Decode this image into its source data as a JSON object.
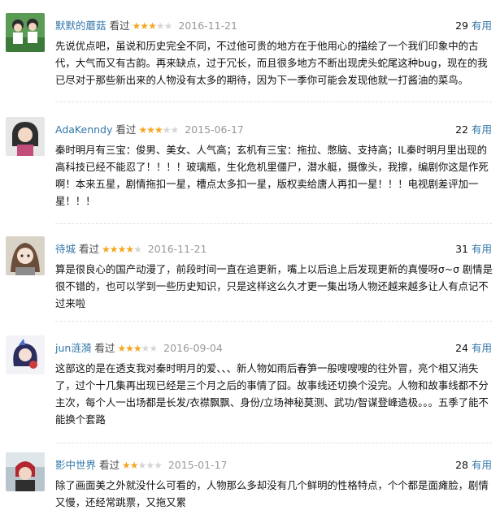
{
  "reviews": [
    {
      "username": "默默的蘑菇",
      "action": "看过",
      "rating": 3,
      "date": "2016-11-21",
      "useful_count": "29",
      "useful_label": "有用",
      "text": "先说优点吧，虽说和历史完全不同，不过他可贵的地方在于他用心的描绘了一个我们印象中的古代，大气而又有古韵。再来缺点，过于冗长，而且很多地方不断出现虎头蛇尾这种bug，现在的我已尽对于那些新出来的人物没有太多的期待，因为下一季你可能会发现他就一打酱油的菜鸟。"
    },
    {
      "username": "AdaKenndy",
      "action": "看过",
      "rating": 3,
      "date": "2015-06-17",
      "useful_count": "22",
      "useful_label": "有用",
      "text": "秦时明月有三宝：俊男、美女、人气高；玄机有三宝：拖拉、憋脑、支持高；IL秦时明月里出现的高科技已经不能忍了！！！！玻璃瓶，生化危机里僵尸，潜水艇，摄像头，我擦，编剧你这是作死啊！本来五星，剧情拖扣一星，槽点太多扣一星，版权卖给唐人再扣一星！！！电视剧差评加一星！！！"
    },
    {
      "username": "待城",
      "action": "看过",
      "rating": 4,
      "date": "2016-11-21",
      "useful_count": "31",
      "useful_label": "有用",
      "text": "算是很良心的国产动漫了，前段时间一直在追更新，嘴上以后追上后发现更新的真慢呀σ~σ 剧情是很不错的，也可以学到一些历史知识，只是这样这么久才更一集出场人物还越来越多让人有点记不过来啦"
    },
    {
      "username": "jun涟漪",
      "action": "看过",
      "rating": 3,
      "date": "2016-09-04",
      "useful_count": "24",
      "useful_label": "有用",
      "text": "这部这的是在透支我对秦时明月的爱、、、新人物如雨后春笋一般嗖嗖嗖的往外冒，亮个相又消失了，过个十几集再出现已经是三个月之后的事情了囧。故事线还切换个没完。人物和故事线都不分主次，每个人一出场都是长发/衣襟飘飘、身份/立场神秘莫测、武功/智谋登峰造极。。。五季了能不能换个套路"
    },
    {
      "username": "影中世界",
      "action": "看过",
      "rating": 2,
      "date": "2015-01-17",
      "useful_count": "28",
      "useful_label": "有用",
      "text": "除了画面美之外就没什么可看的，人物那么多却没有几个鲜明的性格特点，个个都是面瘫脸，剧情又慢，还经常跳票，又拖又累"
    }
  ],
  "colors": {
    "link": "#3377aa",
    "star": "#f5a623",
    "date": "#999999",
    "text": "#111111"
  },
  "icons": [
    "star-icon",
    "avatar-image"
  ]
}
